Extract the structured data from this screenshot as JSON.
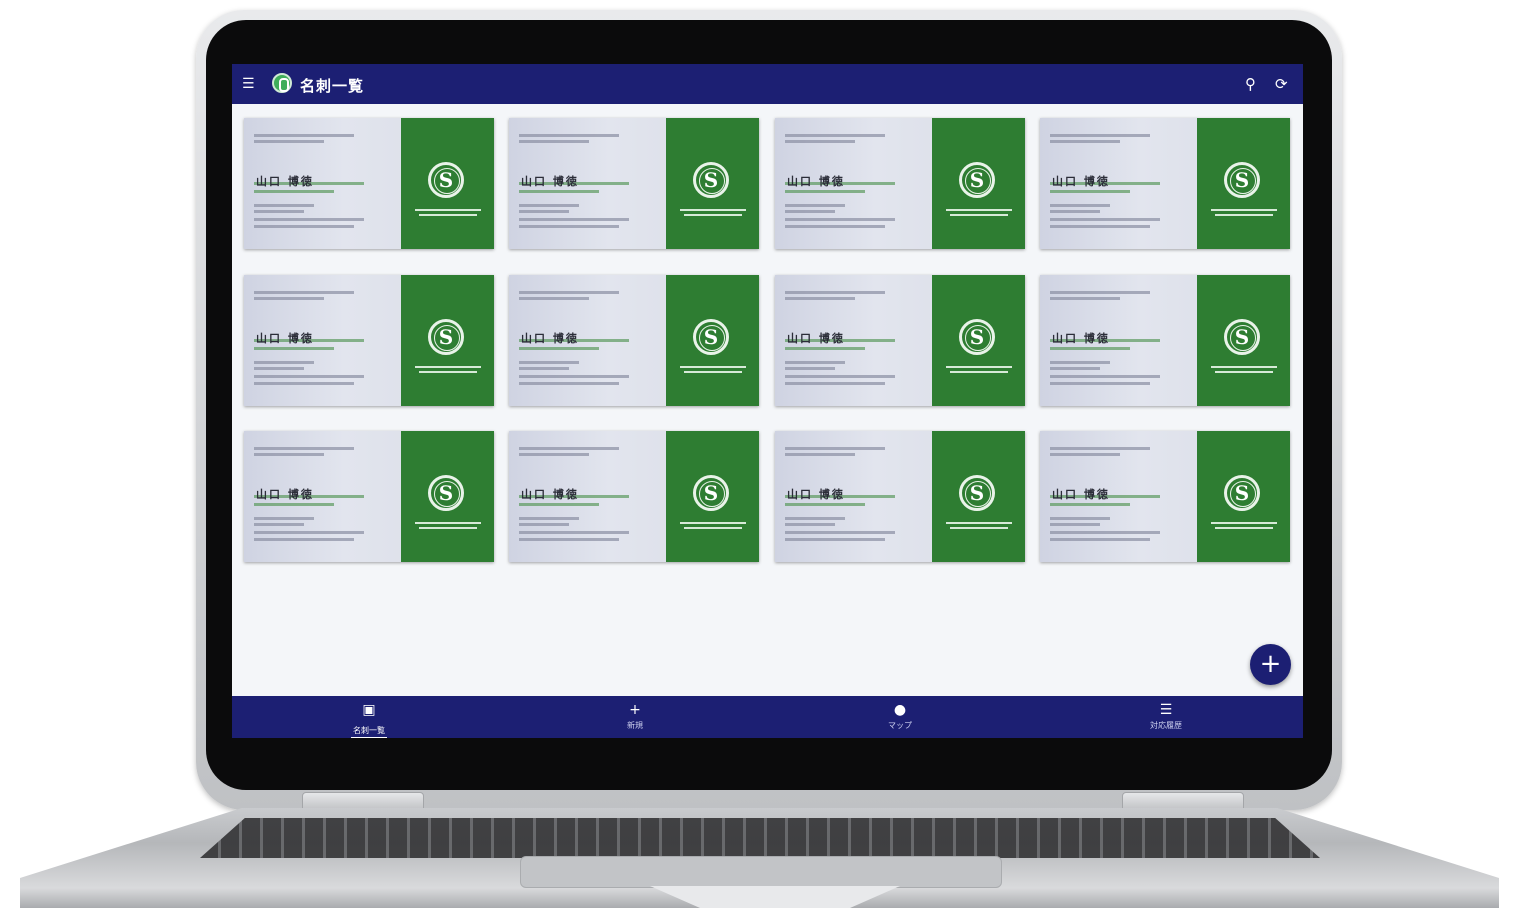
{
  "app": {
    "title": "名刺一覧"
  },
  "header": {
    "menu_icon": "sort-menu-icon",
    "search_icon": "search-icon",
    "refresh_icon": "refresh-icon"
  },
  "cards": [
    {
      "name": "山口 博徳"
    },
    {
      "name": "山口 博徳"
    },
    {
      "name": "山口 博徳"
    },
    {
      "name": "山口 博徳"
    },
    {
      "name": "山口 博徳"
    },
    {
      "name": "山口 博徳"
    },
    {
      "name": "山口 博徳"
    },
    {
      "name": "山口 博徳"
    },
    {
      "name": "山口 博徳"
    },
    {
      "name": "山口 博徳"
    },
    {
      "name": "山口 博徳"
    },
    {
      "name": "山口 博徳"
    }
  ],
  "fab": {
    "label": "+"
  },
  "bottom_nav": [
    {
      "label": "名刺一覧",
      "icon": "card-list-icon",
      "glyph": "▣",
      "active": true
    },
    {
      "label": "新規",
      "icon": "plus-icon",
      "glyph": "+"
    },
    {
      "label": "マップ",
      "icon": "map-pin-icon",
      "glyph": "●"
    },
    {
      "label": "対応履歴",
      "icon": "list-icon",
      "glyph": "☰"
    }
  ],
  "colors": {
    "primary": "#1c1f73",
    "card_green": "#2e7d32",
    "background": "#f4f6f9"
  }
}
